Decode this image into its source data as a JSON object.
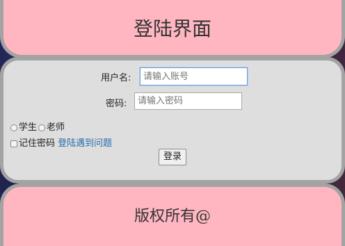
{
  "header": {
    "title": "登陆界面"
  },
  "form": {
    "username_label": "用户名:",
    "username_placeholder": "请输入账号",
    "password_label": "密码:",
    "password_placeholder": "请输入密码",
    "role_student": "学生",
    "role_teacher": "老师",
    "remember_label": "记住密码",
    "help_link": "登陆遇到问题",
    "submit_label": "登录"
  },
  "footer": {
    "text": "版权所有@"
  }
}
